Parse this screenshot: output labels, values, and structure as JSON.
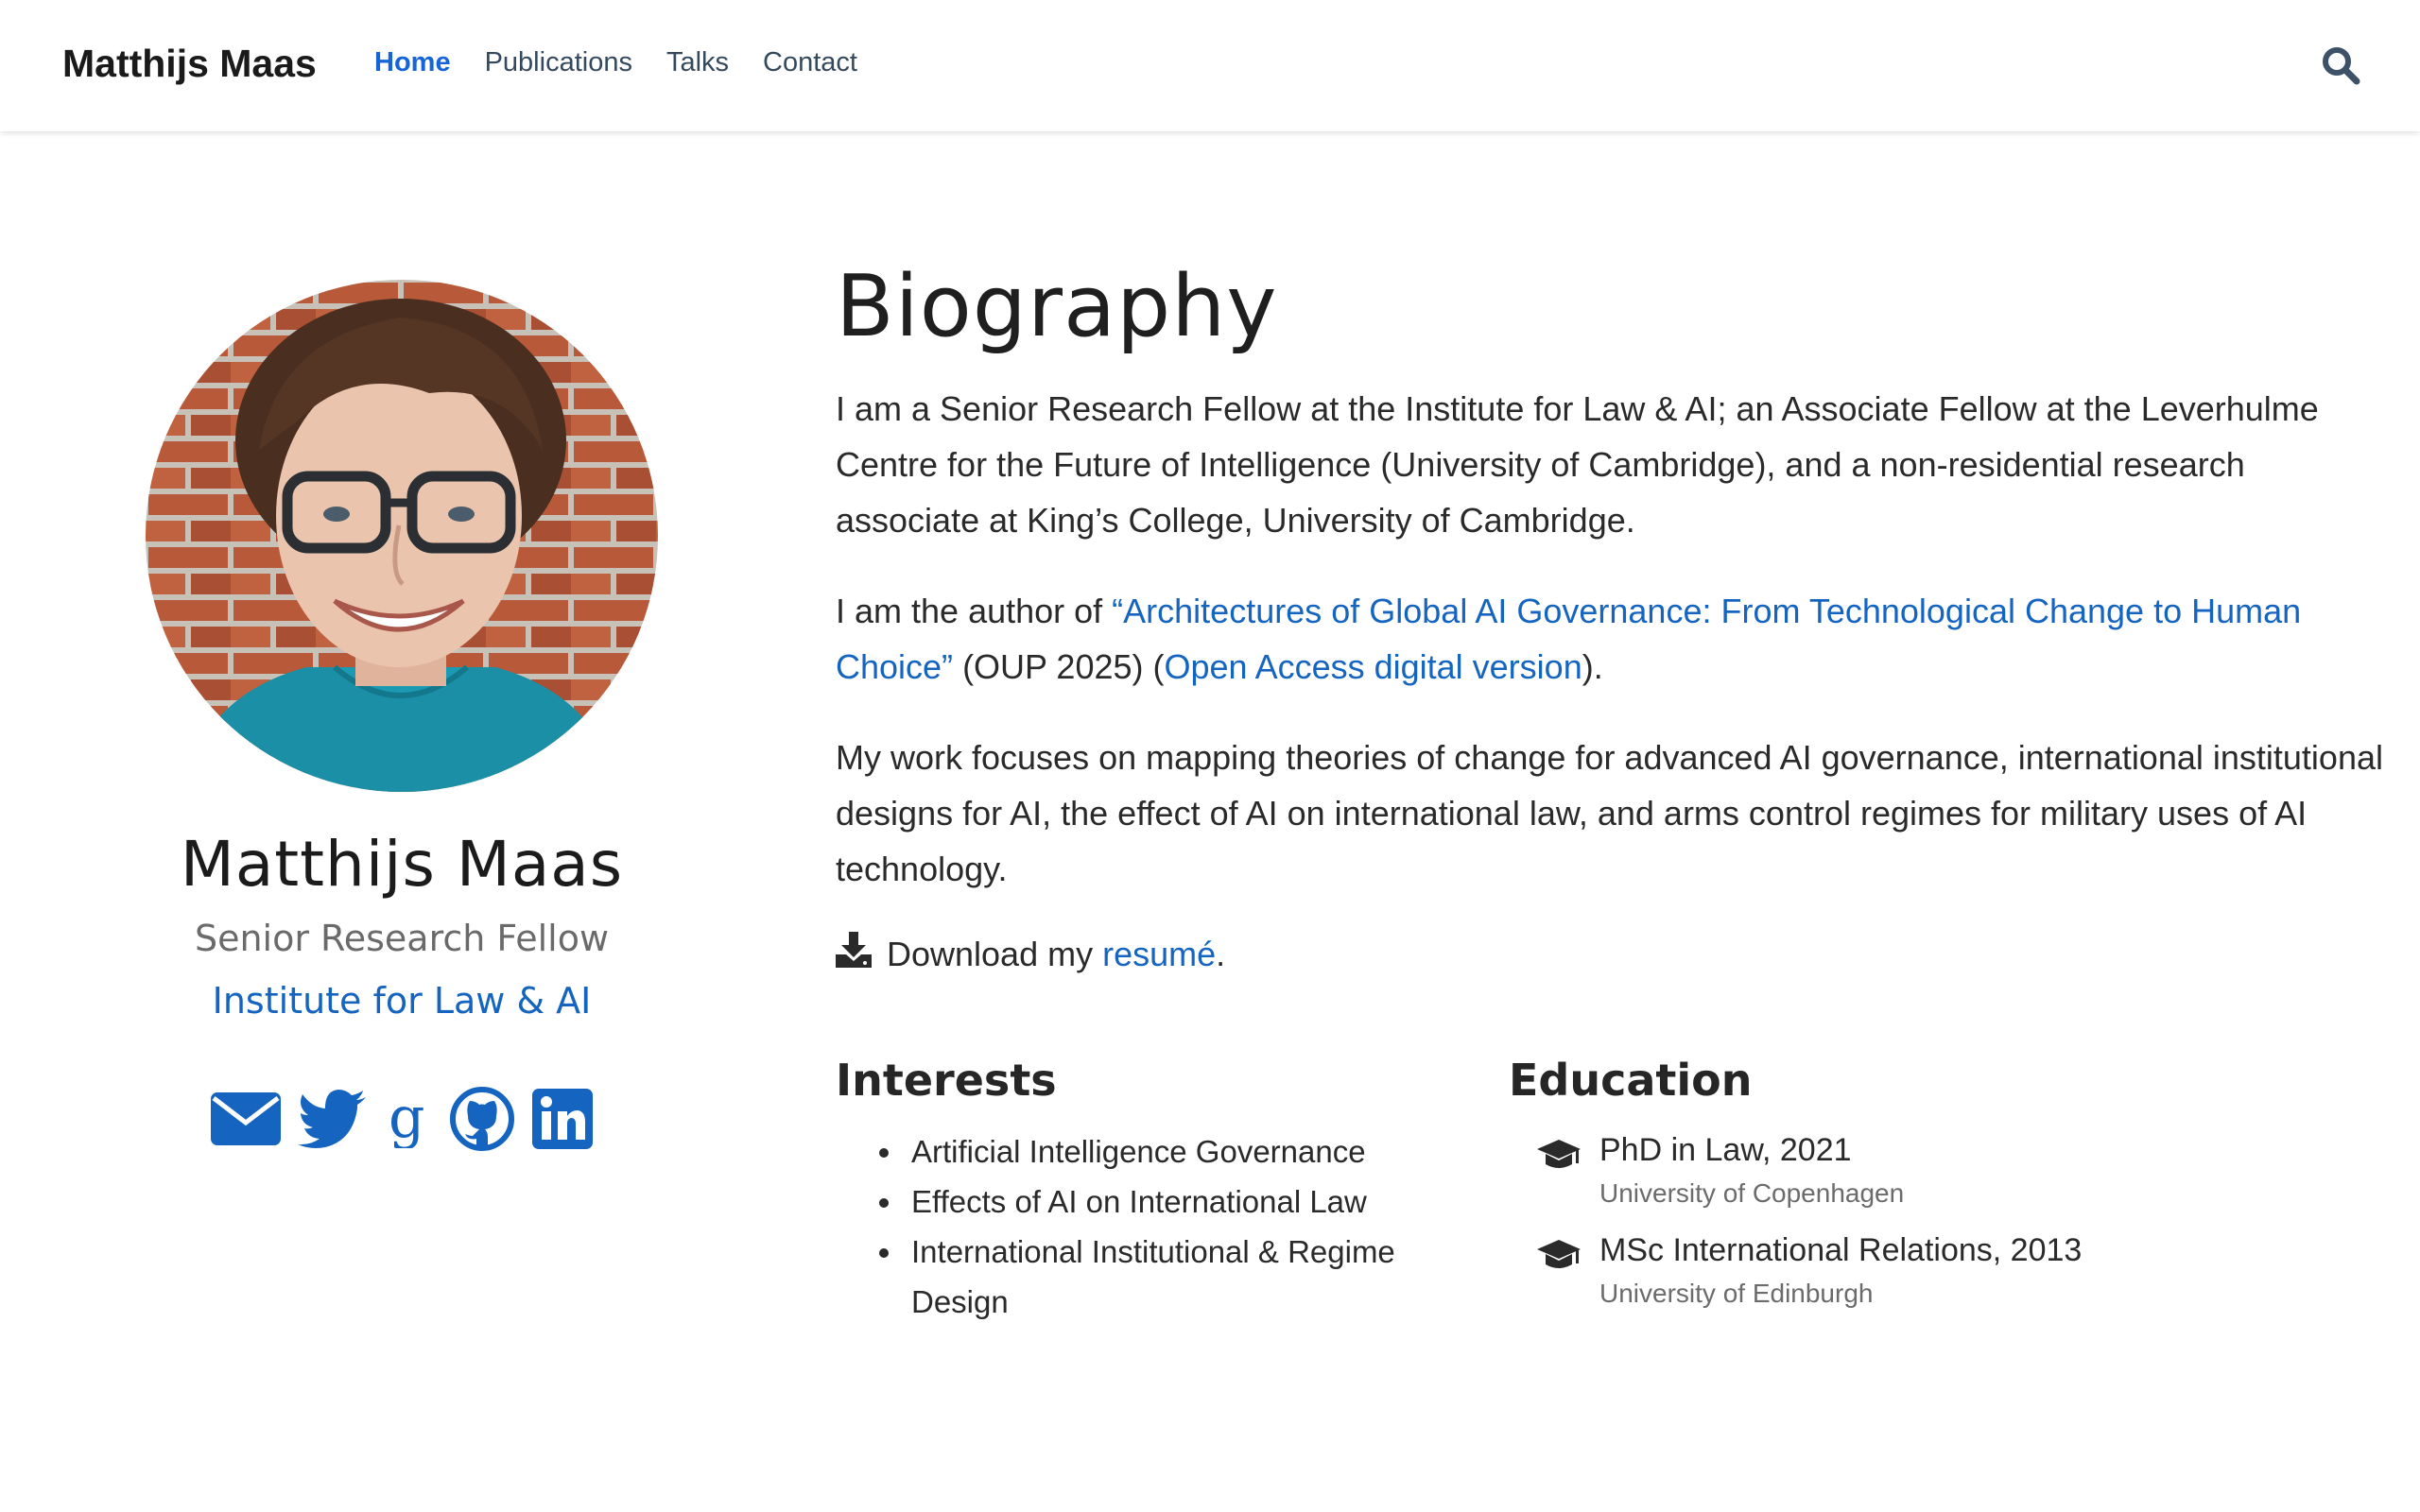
{
  "navbar": {
    "brand": "Matthijs Maas",
    "links": [
      {
        "label": "Home"
      },
      {
        "label": "Publications"
      },
      {
        "label": "Talks"
      },
      {
        "label": "Contact"
      }
    ],
    "search_icon": "search-icon"
  },
  "profile": {
    "name": "Matthijs Maas",
    "role": "Senior Research Fellow",
    "organization": "Institute for Law & AI",
    "social_icons": [
      "envelope-icon",
      "twitter-icon",
      "google-scholar-icon",
      "github-icon",
      "linkedin-icon"
    ]
  },
  "biography": {
    "title": "Biography",
    "p1": "I am a Senior Research Fellow at the Institute for Law & AI; an Associate Fellow at the Leverhulme Centre for the Future of Intelligence (University of Cambridge), and a non-residential research associate at King’s College, University of Cambridge.",
    "p2_prefix": "I am the author of ",
    "p2_book_link": "“Architectures of Global AI Governance: From Technological Change to Human Choice”",
    "p2_middle": " (OUP 2025) (",
    "p2_oa_link": "Open Access digital version",
    "p2_suffix": ").",
    "p3": "My work focuses on mapping theories of change for advanced AI governance, international institutional designs for AI, the effect of AI on international law, and arms control regimes for military uses of AI technology.",
    "download_prefix": "Download my ",
    "download_link": "resumé",
    "download_suffix": "."
  },
  "interests": {
    "title": "Interests",
    "items": [
      "Artificial Intelligence Governance",
      "Effects of AI on International Law",
      "International Institutional & Regime Design"
    ]
  },
  "education": {
    "title": "Education",
    "items": [
      {
        "degree": "PhD in Law, 2021",
        "school": "University of Copenhagen"
      },
      {
        "degree": "MSc International Relations, 2013",
        "school": "University of Edinburgh"
      }
    ]
  },
  "colors": {
    "accent": "#1565c0",
    "nav_active": "#1565d8",
    "text": "#2a2a2a",
    "muted": "#6b6b6b"
  }
}
